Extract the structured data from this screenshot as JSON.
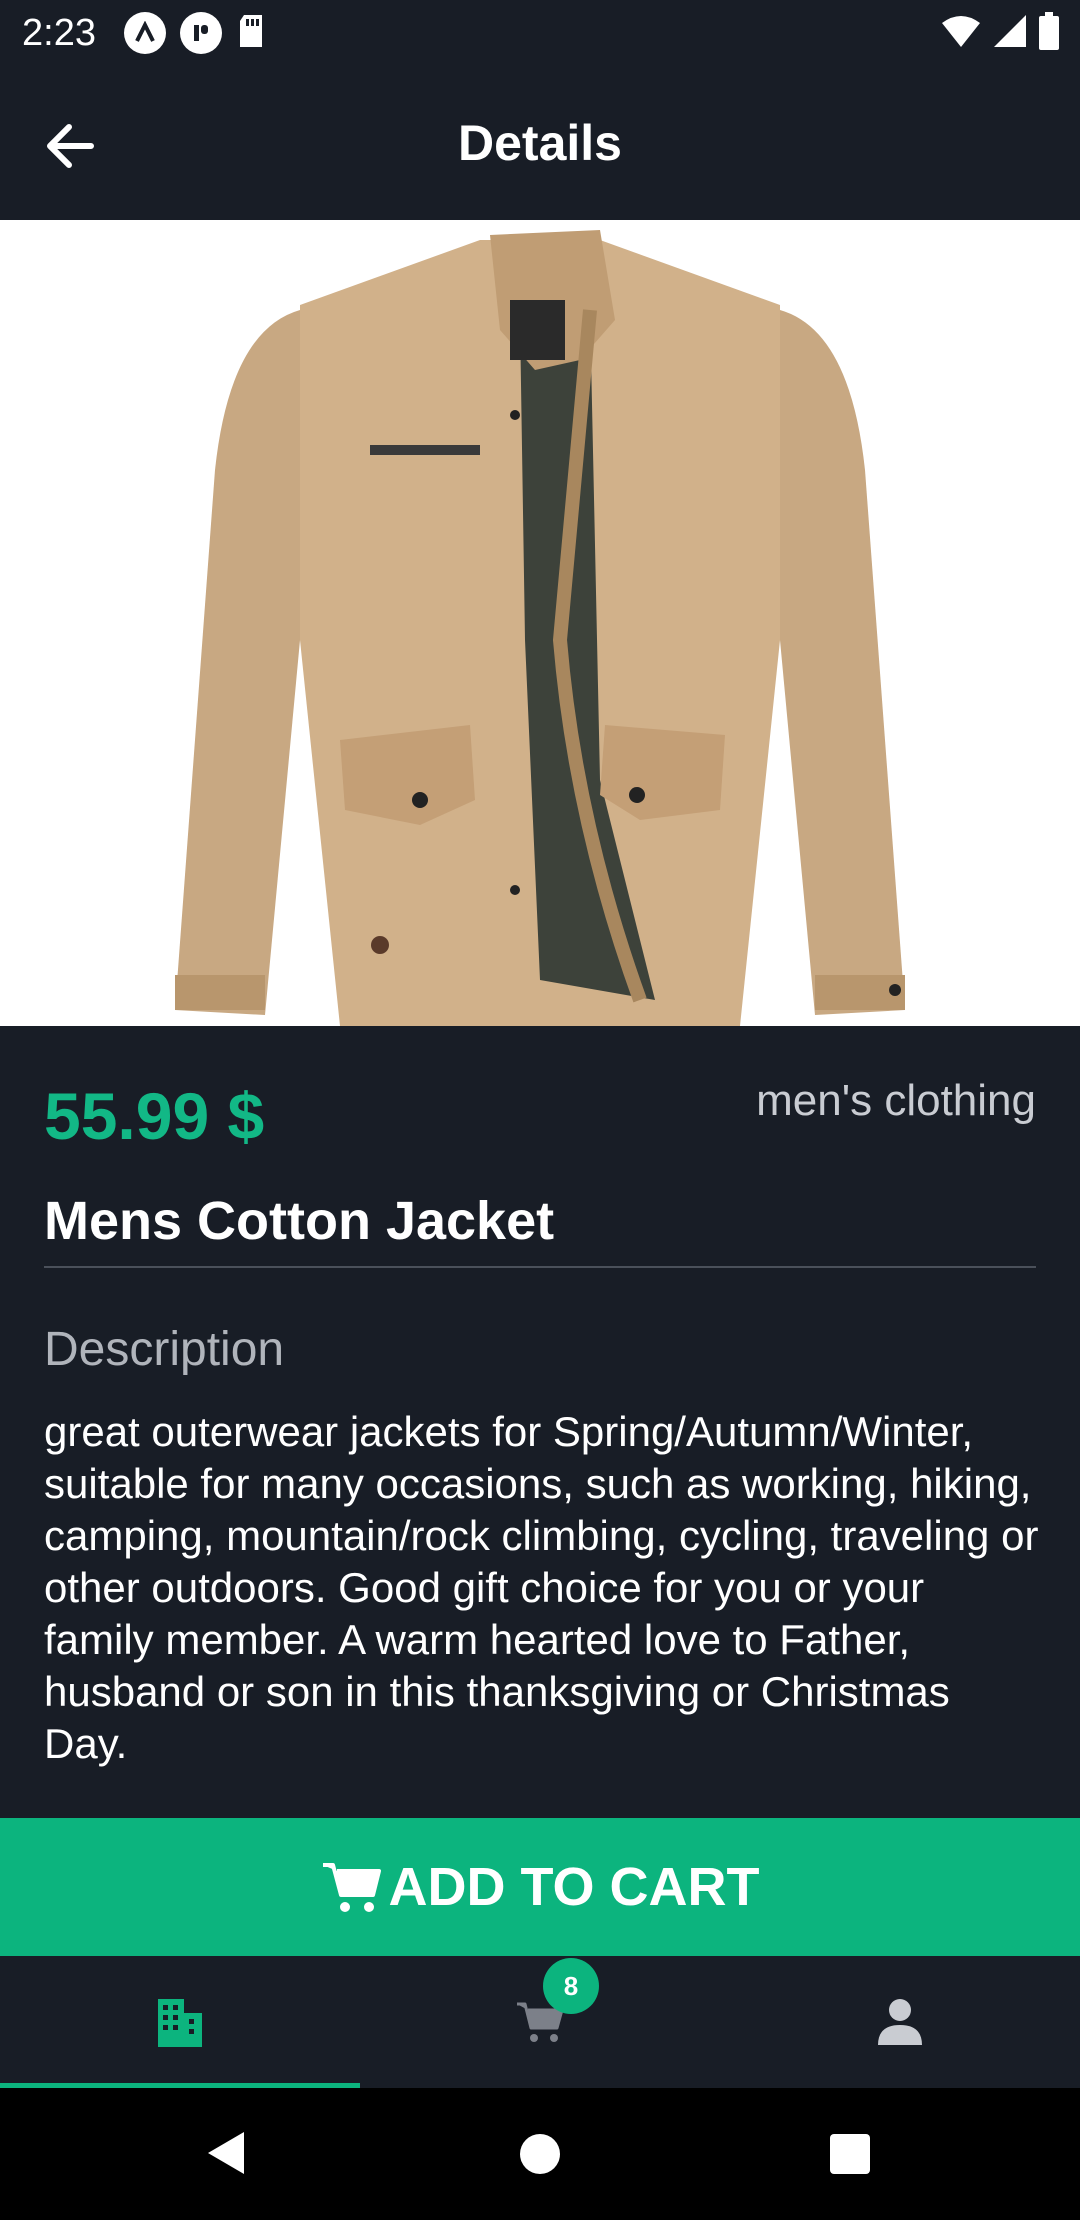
{
  "status_bar": {
    "time": "2:23",
    "left_icons": [
      "a-icon",
      "p-icon",
      "sdcard-icon"
    ],
    "right_icons": [
      "wifi-icon",
      "signal-icon",
      "battery-icon"
    ]
  },
  "app_bar": {
    "title": "Details",
    "back_icon": "arrow-left-icon"
  },
  "product": {
    "price": "55.99 $",
    "category": "men's clothing",
    "title": "Mens Cotton Jacket",
    "description_label": "Description",
    "description": "great outerwear jackets for Spring/Autumn/Winter, suitable for many occasions, such as working, hiking, camping, mountain/rock climbing, cycling, traveling or other outdoors. Good gift choice for you or your family member. A warm hearted love to Father, husband or son in this thanksgiving or Christmas Day.",
    "image_alt": "khaki cotton jacket"
  },
  "add_to_cart": {
    "label": "ADD TO CART",
    "icon": "cart-icon"
  },
  "bottom_nav": {
    "items": [
      {
        "name": "store",
        "icon": "building-icon",
        "active": true
      },
      {
        "name": "cart",
        "icon": "cart-icon",
        "active": false,
        "badge": "8"
      },
      {
        "name": "profile",
        "icon": "person-icon",
        "active": false
      }
    ]
  },
  "colors": {
    "background": "#181d26",
    "accent": "#0cb47e",
    "price": "#12b886",
    "muted": "#b0b4bb"
  }
}
